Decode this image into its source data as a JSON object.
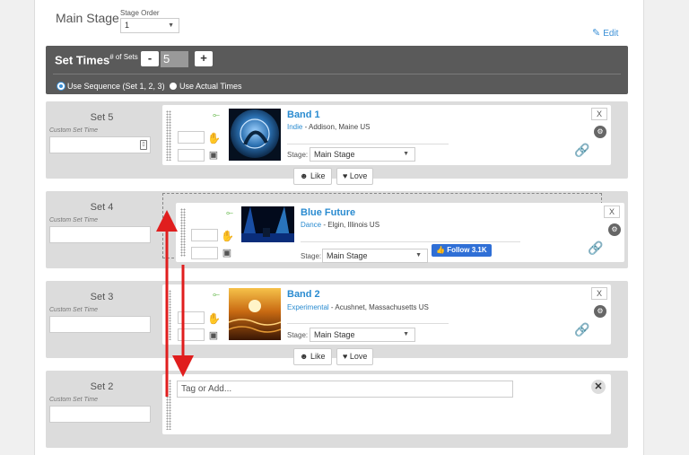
{
  "stage": {
    "title": "Main Stage",
    "order_label": "Stage Order",
    "order_value": "1",
    "edit_label": "Edit"
  },
  "set_times": {
    "title": "Set Times",
    "sets_label": "# of Sets",
    "minus": "-",
    "plus": "+",
    "count": "5",
    "radio_sequence": "Use Sequence (Set 1, 2, 3)",
    "radio_actual": "Use Actual Times",
    "selected": "sequence"
  },
  "sets": [
    {
      "name": "Set 5",
      "custom_label": "Custom Set Time",
      "band": {
        "name": "Band 1",
        "genre": "Indie",
        "location": " - Addison, Maine US",
        "stage_label": "Stage:",
        "stage_value": "Main Stage"
      },
      "like": "Like",
      "love": "Love",
      "remove": "X"
    },
    {
      "name": "Set 4",
      "custom_label": "Custom Set Time",
      "band": {
        "name": "Blue Future",
        "genre": "Dance",
        "location": " - Elgin, Illinois US",
        "stage_label": "Stage:",
        "stage_value": "Main Stage"
      },
      "follow": "Follow 3.1K",
      "remove": "X"
    },
    {
      "name": "Set 3",
      "custom_label": "Custom Set Time",
      "band": {
        "name": "Band 2",
        "genre": "Experimental",
        "location": " - Acushnet, Massachusetts US",
        "stage_label": "Stage:",
        "stage_value": "Main Stage"
      },
      "like": "Like",
      "love": "Love",
      "remove": "X"
    },
    {
      "name": "Set 2",
      "custom_label": "Custom Set Time",
      "tag_placeholder": "Tag or Add...",
      "close": "✕"
    }
  ],
  "icons": {
    "caret": "▼",
    "pencil": "✎",
    "calendar": "▯",
    "hand": "✋",
    "bus": "▣",
    "leaf": "⟜",
    "gear": "⚙",
    "link": "🔗",
    "smile": "☻",
    "heart": "♥",
    "thumb": "👍"
  },
  "colors": {
    "accent": "#2a8bd0",
    "header": "#5a5a5a",
    "arrow": "#e01e1e"
  }
}
